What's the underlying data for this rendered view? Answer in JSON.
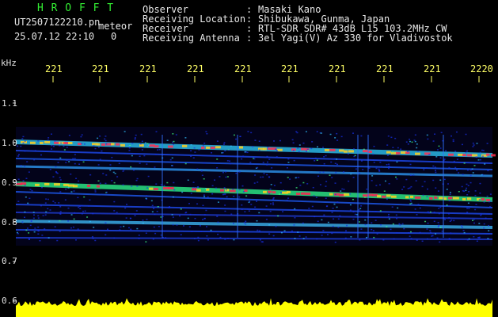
{
  "header": {
    "title": "H R O F F T",
    "filename": "UT2507122210.pn",
    "filename_suffix": "meteor",
    "datetime": "25.07.12 22:10",
    "frame_index": "0",
    "fields": [
      {
        "label": "Observer",
        "value": "Masaki Kano"
      },
      {
        "label": "Receiving Location",
        "value": "Shibukawa, Gunma, Japan"
      },
      {
        "label": "Receiver",
        "value": "RTL-SDR SDR# 43dB L15 103.2MHz CW"
      },
      {
        "label": "Receiving Antenna",
        "value": "3el Yagi(V) Az 330 for Vladivostok"
      }
    ]
  },
  "axis": {
    "unit": "kHz",
    "y_ticks": [
      "1.1",
      "1.0",
      "0.9",
      "0.8",
      "0.7",
      "0.6"
    ],
    "x_ticks": [
      "221",
      "221",
      "221",
      "221",
      "221",
      "221",
      "221",
      "221",
      "221",
      "2220"
    ]
  },
  "colors": {
    "title": "#33ee33",
    "ticks": "#ffff66",
    "background": "#000000",
    "strong_echo": "#ff3050",
    "noise": "#1020e0",
    "power_trace": "#ffff00"
  }
}
